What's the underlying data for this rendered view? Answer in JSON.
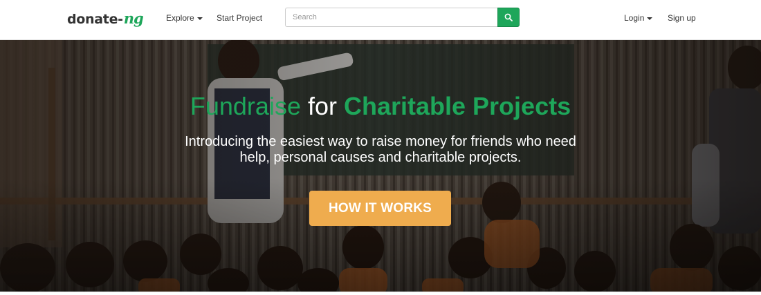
{
  "navbar": {
    "logo_main": "donate-",
    "logo_accent": "ng",
    "explore_label": "Explore",
    "start_project_label": "Start Project",
    "search_placeholder": "Search",
    "search_icon": "search-icon",
    "login_label": "Login",
    "signup_label": "Sign up"
  },
  "hero": {
    "title_part1": "Fundraise",
    "title_part2": " for ",
    "title_part3": "Charitable Projects",
    "subtitle": "Introducing the easiest way to raise money for friends who need help, personal causes and charitable projects.",
    "cta_label": "HOW IT WORKS"
  },
  "colors": {
    "brand_green": "#1ea65a",
    "cta_orange": "#efac4e",
    "text_dark": "#333333"
  }
}
